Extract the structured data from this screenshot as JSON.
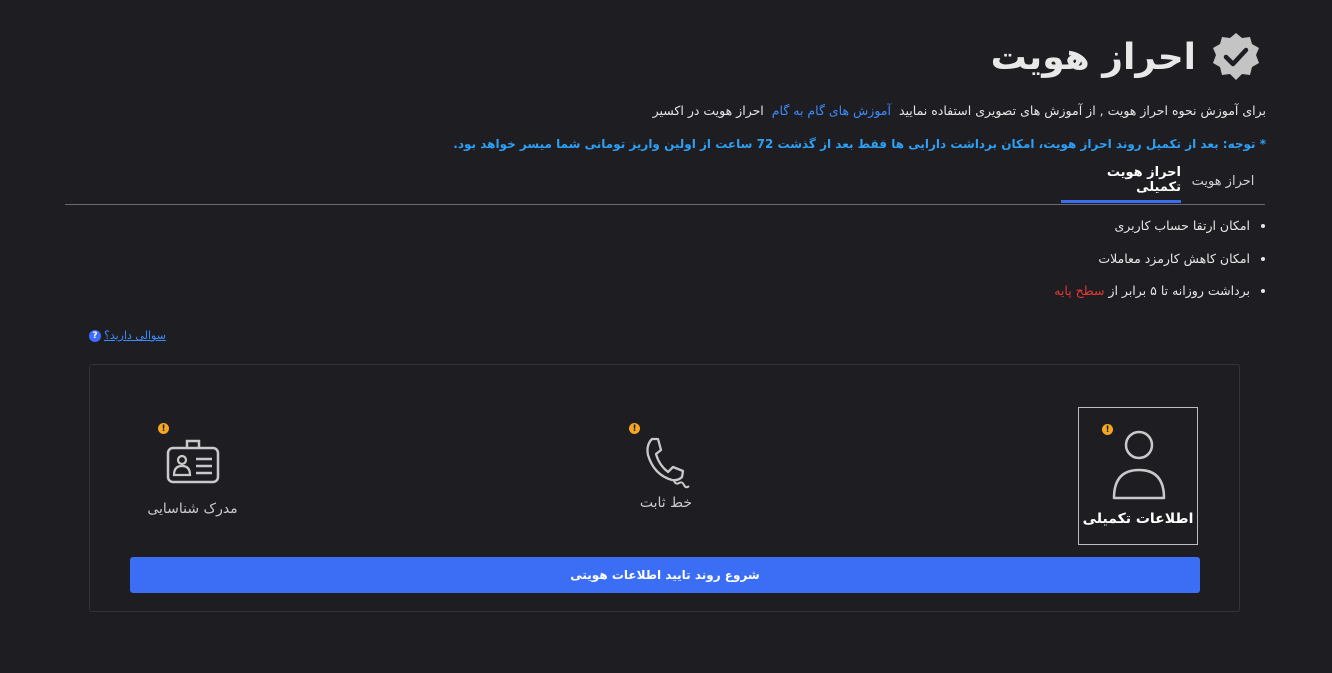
{
  "page_title": "احراز هویت",
  "intro": {
    "text_before": "برای آموزش نحوه احراز هویت , از آموزش های تصویری استفاده نمایید",
    "link": "آموزش های گام به گام",
    "text_after": "احراز هویت در اکسیر"
  },
  "notice": "* توجه: بعد از تکمیل روند احراز هویت، امکان برداشت دارایی ها فقط بعد از گذشت 72 ساعت از اولین واریز تومانی شما میسر خواهد بود.",
  "tabs": [
    {
      "label": "احراز هویت",
      "active": false
    },
    {
      "label": "احراز هویت تکمیلی",
      "active": true
    }
  ],
  "features": {
    "item1": "امکان ارتقا حساب کاربری",
    "item2": "امکان کاهش کارمزد معاملات",
    "item3_prefix": "برداشت روزانه تا ۵ برابر از",
    "item3_highlight": "سطح پایه"
  },
  "help": {
    "label": "سوالی دارید؟",
    "icon": "?"
  },
  "steps": {
    "personal_info": {
      "label": "اطلاعات تکمیلی",
      "icon": "user-icon",
      "status": "warning"
    },
    "landline": {
      "label": "خط ثابت",
      "icon": "phone-icon",
      "status": "warning"
    },
    "id_document": {
      "label": "مدرک شناسایی",
      "icon": "id-card-icon",
      "status": "warning"
    }
  },
  "warning_glyph": "!",
  "start_button": "شروع روند تایید اطلاعات هویتی",
  "colors": {
    "background": "#1e1d22",
    "accent": "#3b6ef5",
    "link": "#3d8bfd",
    "notice": "#2e9ff2",
    "warning": "#f5a623",
    "highlight_red": "#e53935"
  }
}
